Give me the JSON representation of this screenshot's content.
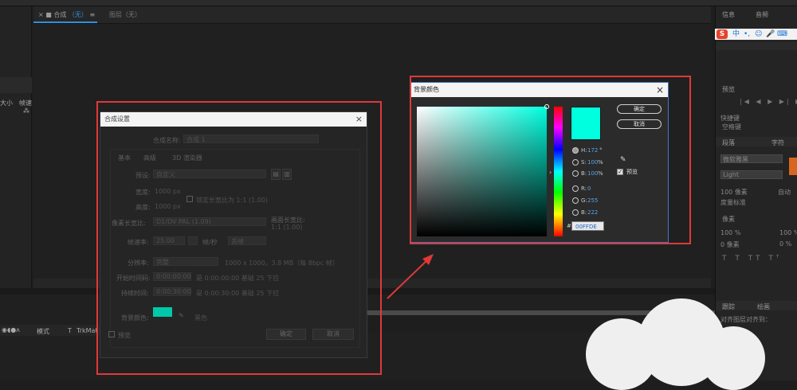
{
  "comp_panel": {
    "tab_label": "合成",
    "tab_name": "（无）",
    "layer_tab": "图层（无）"
  },
  "left_panel": {
    "col_a": "大小",
    "col_b": "帧速"
  },
  "right_panel": {
    "tab_info": "信息",
    "tab_audio": "音频",
    "preview_tab": "预览",
    "shortcut_label": "快捷键",
    "shortcut_value": "空格键",
    "para_tab": "段落",
    "char_tab": "字符",
    "font_value": "微软雅黑",
    "style_value": "Light",
    "size_value": "100 像素",
    "auto_label": "自动",
    "leading_label": "度量标准",
    "px_label": "像素",
    "scale_h": "100 %",
    "scale_v": "100 %",
    "baseline": "0 像素",
    "tsume": "0 %",
    "ime_items": [
      "中",
      "•,",
      "☺",
      "🎤",
      "⌨"
    ],
    "bottom_tab_a": "跟踪",
    "bottom_tab_b": "绘画",
    "bottom_line": "对齐图层对齐到："
  },
  "timeline": {
    "mode_label": "模式",
    "t_label": "T",
    "trkmat_label": "TrkMat"
  },
  "comp_settings_dialog": {
    "title": "合成设置",
    "name_label": "合成名称:",
    "name_value": "合成 1",
    "tabs": [
      "基本",
      "高级",
      "3D 渲染器"
    ],
    "preset_label": "预设:",
    "preset_value": "自定义",
    "width_label": "宽度:",
    "width_value": "1000 px",
    "lock_label": "锁定长宽比为 1:1 (1.00)",
    "height_label": "高度:",
    "height_value": "1000 px",
    "par_label": "像素长宽比:",
    "par_value": "D1/DV PAL (1.09)",
    "frame_aspect_label": "画面长宽比:",
    "frame_aspect_value": "1:1 (1.00)",
    "fps_label": "帧速率:",
    "fps_value": "25.00",
    "fps_unit": "帧/秒",
    "drop_value": "丢帧",
    "res_label": "分辨率:",
    "res_value": "完整",
    "res_info": "1000 x 1000，3.8 MB（每 8bpc 帧）",
    "start_label": "开始时间码:",
    "start_value": "0:00:00:00",
    "start_info": "是 0:00:00:00  基础 25  下拉",
    "dur_label": "持续时间:",
    "dur_value": "0:00:30:00",
    "dur_info": "是 0:00:30:00  基础 25  下拉",
    "bgcolor_label": "背景颜色:",
    "bgcolor_name": "黑色",
    "preview_label": "预览",
    "ok_label": "确定",
    "cancel_label": "取消"
  },
  "bg_color_dialog": {
    "title": "背景颜色",
    "ok_label": "确定",
    "cancel_label": "取消",
    "current_color": "#00ffde",
    "fields": [
      {
        "label": "H:",
        "value": "172",
        "unit": "°",
        "selected": true
      },
      {
        "label": "S:",
        "value": "100",
        "unit": "%",
        "selected": false
      },
      {
        "label": "B:",
        "value": "100",
        "unit": "%",
        "selected": false
      },
      {
        "label": "R:",
        "value": "0",
        "unit": "",
        "selected": false
      },
      {
        "label": "G:",
        "value": "255",
        "unit": "",
        "selected": false
      },
      {
        "label": "B:",
        "value": "222",
        "unit": "",
        "selected": false
      }
    ],
    "hex_prefix": "#",
    "hex_value": "00FFDE",
    "preview_label": "预览"
  }
}
